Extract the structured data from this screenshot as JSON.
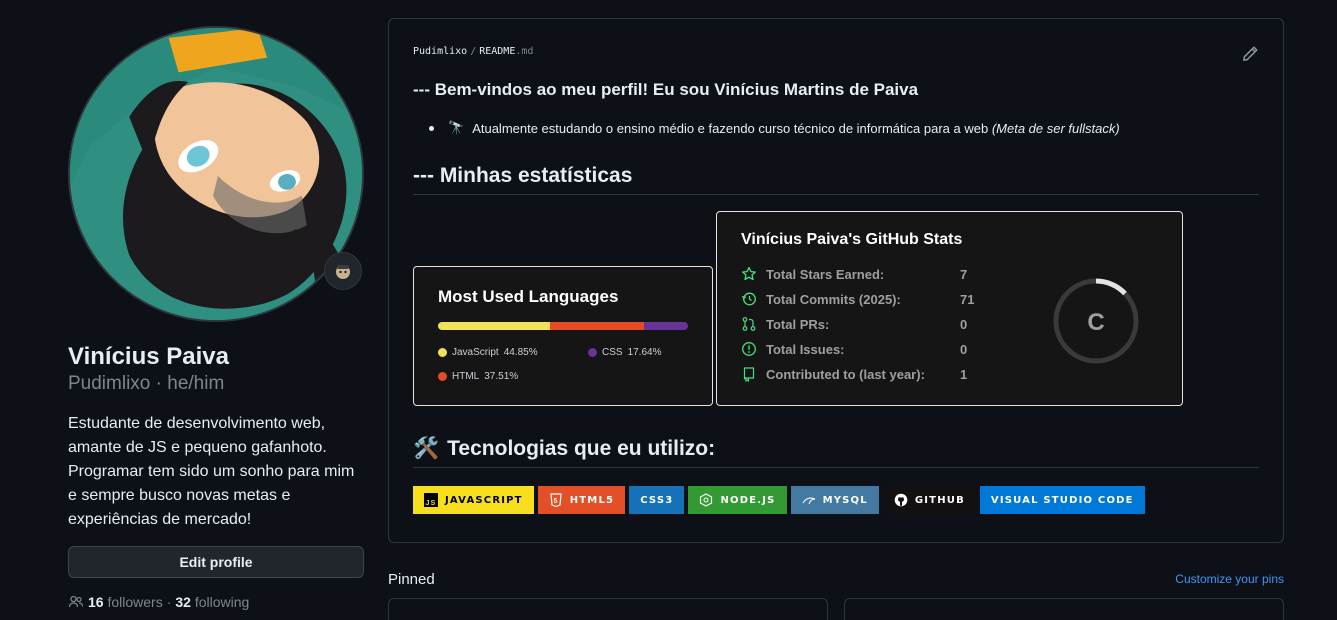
{
  "profile": {
    "name": "Vinícius Paiva",
    "login_line": "Pudimlixo · he/him",
    "bio": "Estudante de desenvolvimento web, amante de JS e pequeno gafanhoto. Programar tem sido um sonho para mim e sempre busco novas metas e experiências de mercado!",
    "edit_button": "Edit profile",
    "followers_count": "16",
    "followers_label": "followers",
    "separator": "·",
    "following_count": "32",
    "following_label": "following"
  },
  "readme": {
    "owner": "Pudimlixo",
    "slash": "/",
    "file_name": "README",
    "file_ext": ".md",
    "welcome": "--- Bem-vindos ao meu perfil! Eu sou Vinícius Martins de Paiva",
    "bullet_emoji": "🔭",
    "bullet_text": "Atualmente estudando o ensino médio e fazendo curso técnico de informática para a web",
    "bullet_italic": "(Meta de ser fullstack)",
    "stats_heading": "--- Minhas estatísticas",
    "tech_emoji": "🛠️",
    "tech_heading": "Tecnologias que eu utilizo:"
  },
  "languages_card": {
    "title": "Most Used Languages",
    "items": [
      {
        "name": "JavaScript",
        "percent": "44.85%",
        "value": 44.85,
        "color": "#f1e05a"
      },
      {
        "name": "HTML",
        "percent": "37.51%",
        "value": 37.51,
        "color": "#e34c26"
      },
      {
        "name": "CSS",
        "percent": "17.64%",
        "value": 17.64,
        "color": "#663399"
      }
    ]
  },
  "stats_card": {
    "title": "Vinícius Paiva's GitHub Stats",
    "rows": [
      {
        "icon": "star-icon",
        "label": "Total Stars Earned:",
        "value": "7"
      },
      {
        "icon": "history-icon",
        "label": "Total Commits (2025):",
        "value": "71"
      },
      {
        "icon": "pull-request-icon",
        "label": "Total PRs:",
        "value": "0"
      },
      {
        "icon": "issue-icon",
        "label": "Total Issues:",
        "value": "0"
      },
      {
        "icon": "repo-icon",
        "label": "Contributed to (last year):",
        "value": "1"
      }
    ],
    "rank": "C",
    "accent": "#4ade80"
  },
  "badges": [
    {
      "label": "JAVASCRIPT",
      "bg": "#f7df1e",
      "fg": "#000000",
      "icon": "js-icon"
    },
    {
      "label": "HTML5",
      "bg": "#e34f26",
      "fg": "#ffffff",
      "icon": "html5-icon"
    },
    {
      "label": "CSS3",
      "bg": "#1572b6",
      "fg": "#ffffff",
      "icon": "css3-icon"
    },
    {
      "label": "NODE.JS",
      "bg": "#339933",
      "fg": "#ffffff",
      "icon": "nodejs-icon"
    },
    {
      "label": "MYSQL",
      "bg": "#4479a1",
      "fg": "#ffffff",
      "icon": "mysql-icon"
    },
    {
      "label": "GITHUB",
      "bg": "#121011",
      "fg": "#ffffff",
      "icon": "github-icon"
    },
    {
      "label": "VISUAL STUDIO CODE",
      "bg": "#0078d7",
      "fg": "#ffffff",
      "icon": ""
    }
  ],
  "pinned": {
    "title": "Pinned",
    "customize_link": "Customize your pins"
  }
}
